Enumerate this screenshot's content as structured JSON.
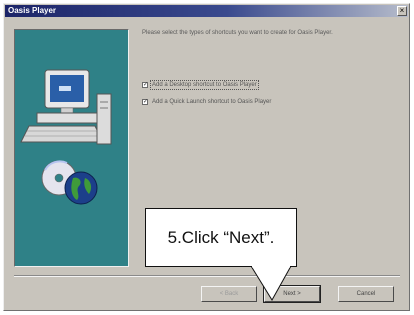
{
  "window": {
    "title": "Oasis Player"
  },
  "titlebar": {
    "close_glyph": "×"
  },
  "instruction": "Please select the types of shortcuts you want to create for Oasis Player.",
  "options": [
    {
      "label": "Add a Desktop shortcut to Oasis Player",
      "checked": true
    },
    {
      "label": "Add a Quick Launch shortcut to Oasis Player",
      "checked": true
    }
  ],
  "buttons": {
    "back": "< Back",
    "next": "Next >",
    "cancel": "Cancel"
  },
  "callout": {
    "text": "5.Click “Next”."
  },
  "colors": {
    "panel": "#2f8187",
    "titlebar": "#1c2468",
    "dialog": "#c8c4bc"
  },
  "icons": [
    "computer-icon",
    "globe-cd-icon",
    "checkbox-icon",
    "close-icon"
  ]
}
